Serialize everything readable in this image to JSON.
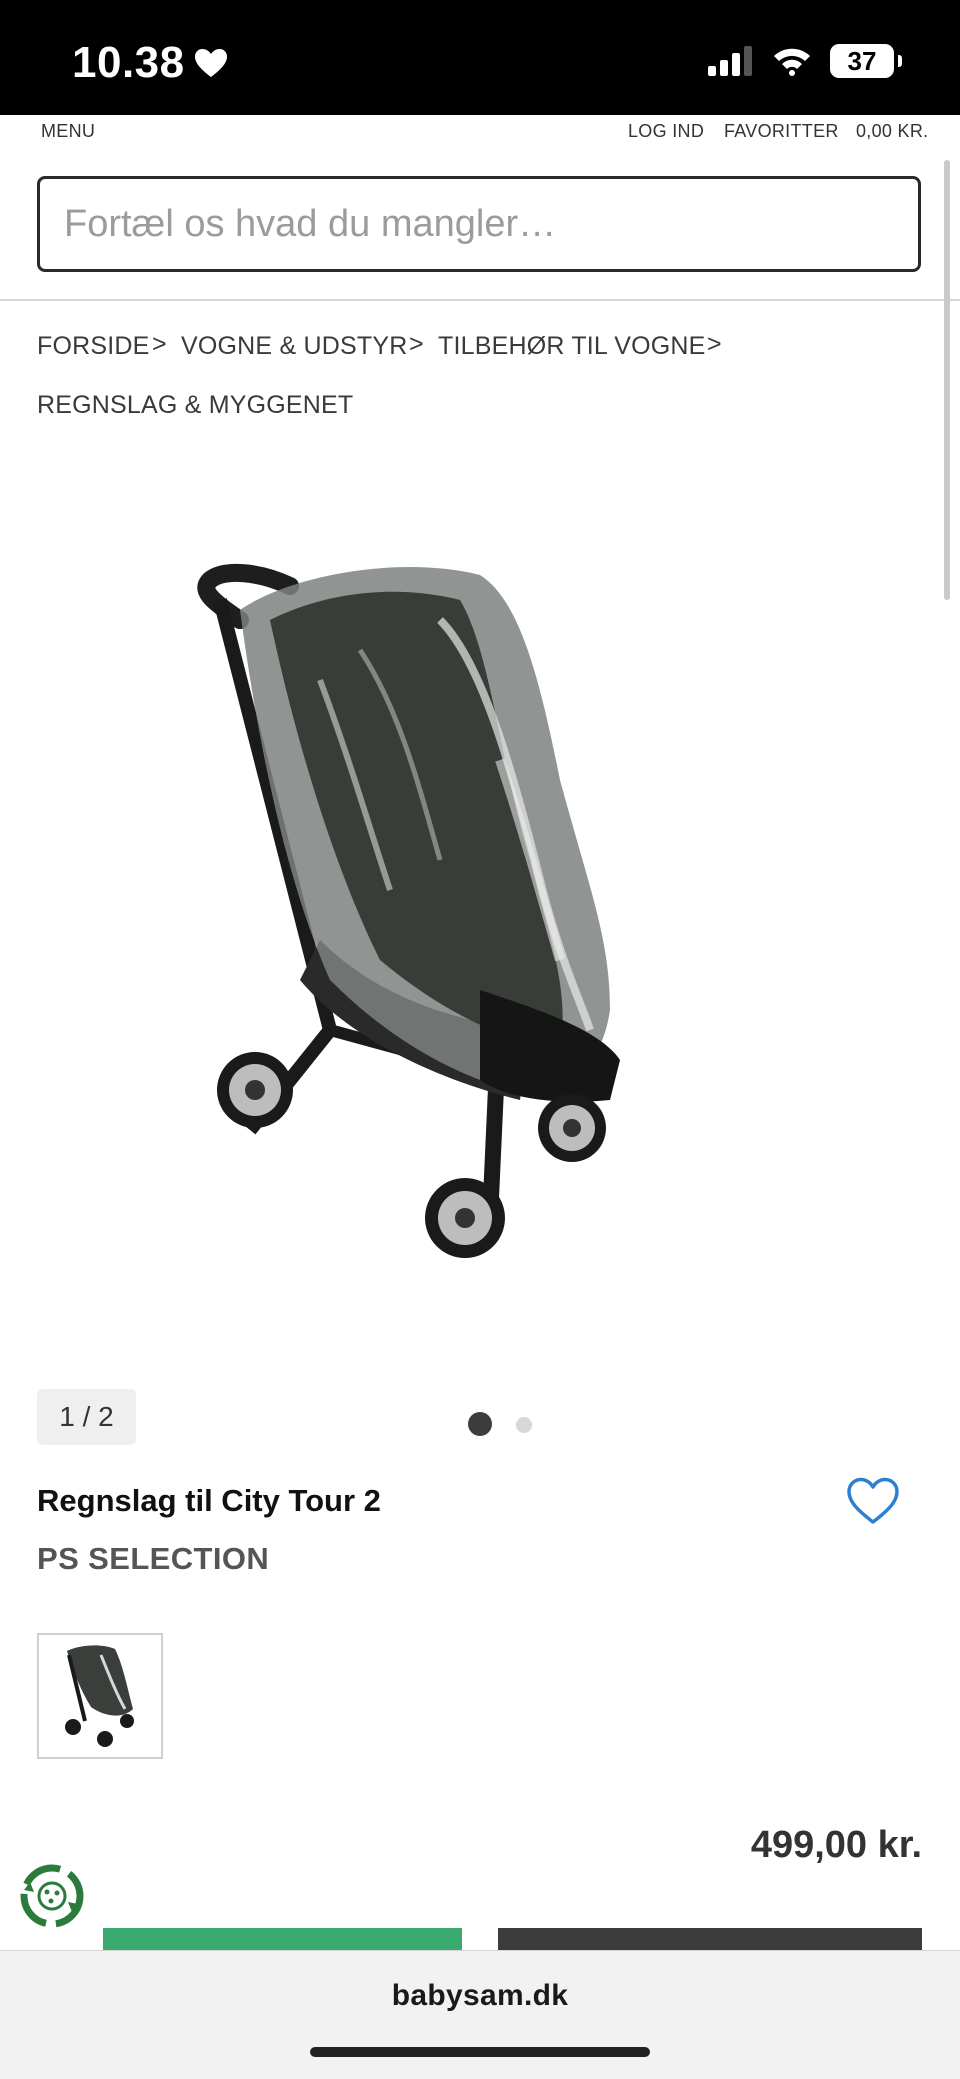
{
  "status_bar": {
    "time": "10.38",
    "battery": "37"
  },
  "header": {
    "menu": "MENU",
    "login": "LOG IND",
    "favorites": "FAVORITTER",
    "cart": "0,00 KR."
  },
  "search": {
    "placeholder": "Fortæl os hvad du mangler…"
  },
  "breadcrumb": {
    "items": [
      "FORSIDE",
      "VOGNE & UDSTYR",
      "TILBEHØR TIL VOGNE",
      "REGNSLAG & MYGGENET"
    ],
    "separator": ">"
  },
  "gallery": {
    "counter": "1 / 2",
    "current": 1,
    "total": 2
  },
  "product": {
    "title": "Regnslag til City Tour 2",
    "brand": "PS SELECTION",
    "price": "499,00 kr."
  },
  "icons": [
    "heart-icon",
    "favorite-heart-icon",
    "signal-icon",
    "wifi-icon",
    "battery-icon",
    "recycle-icon"
  ],
  "colors": {
    "accent_blue": "#2f7fd1",
    "button_green": "#3aaa6e",
    "button_dark": "#3b3b3b"
  },
  "browser": {
    "url": "babysam.dk"
  }
}
